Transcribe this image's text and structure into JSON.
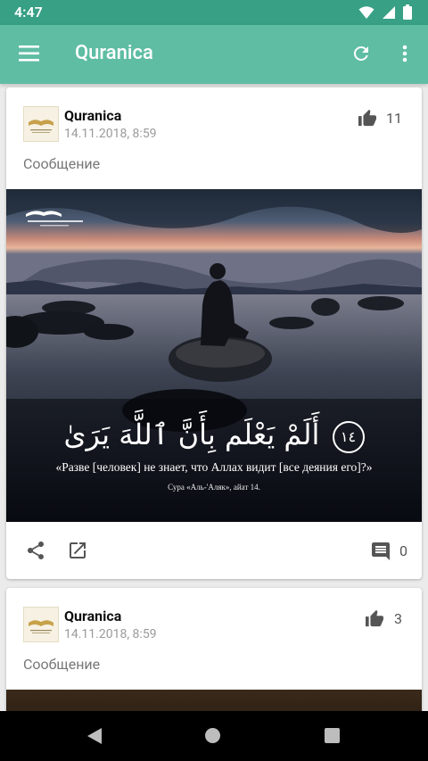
{
  "status_bar": {
    "time": "4:47"
  },
  "toolbar": {
    "title": "Quranica"
  },
  "posts": [
    {
      "author": "Quranica",
      "date": "14.11.2018, 8:59",
      "likes": "11",
      "message": "Сообщение",
      "image": {
        "arabic": "أَلَمْ يَعْلَم بِأَنَّ ٱللَّهَ يَرَىٰ",
        "ayah_number": "١٤",
        "translation": "«Разве [человек] не знает, что Аллах видит [все деяния его]?»",
        "citation": "Сура «Аль-'Аляк», айат 14."
      },
      "comments": "0"
    },
    {
      "author": "Quranica",
      "date": "14.11.2018, 8:59",
      "likes": "3",
      "message": "Сообщение"
    }
  ],
  "colors": {
    "status_bar": "#38a085",
    "toolbar": "#5fbda4",
    "icon_gray": "#555555"
  }
}
